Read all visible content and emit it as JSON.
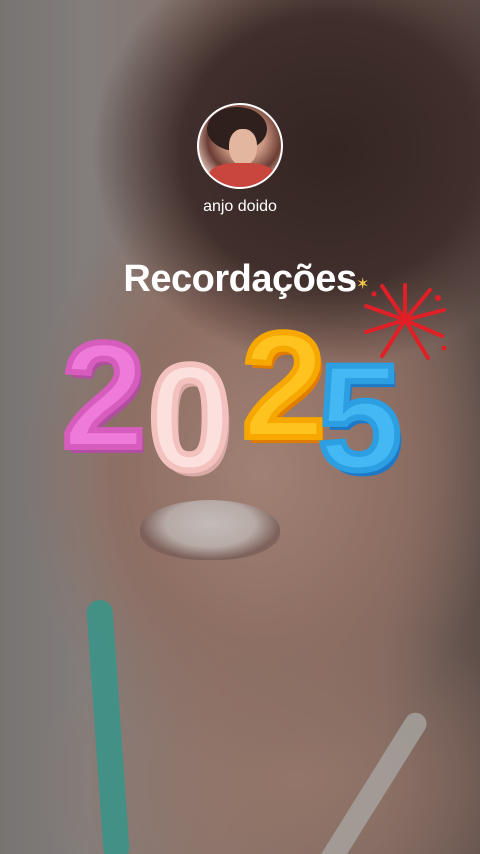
{
  "user": {
    "name": "anjo doido"
  },
  "headline": "Recordações",
  "year": [
    "2",
    "0",
    "2",
    "5"
  ],
  "icons": {
    "avatar": "profile-photo",
    "sparkle": "sparkle-icon",
    "firework": "firework-icon"
  },
  "colors": {
    "digit1": "#ee7ad9",
    "digit2": "#fbe0dd",
    "digit3": "#ffc31f",
    "digit4": "#43b8f3"
  }
}
